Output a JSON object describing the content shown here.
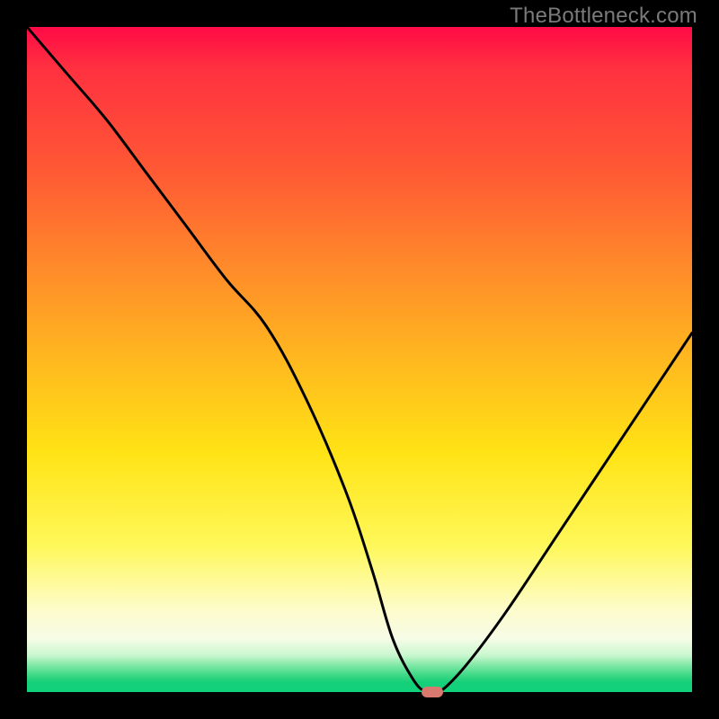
{
  "watermark": "TheBottleneck.com",
  "chart_data": {
    "type": "line",
    "title": "",
    "xlabel": "",
    "ylabel": "",
    "xlim": [
      0,
      100
    ],
    "ylim": [
      0,
      100
    ],
    "grid": false,
    "legend": false,
    "series": [
      {
        "name": "bottleneck-curve",
        "x": [
          0,
          6,
          12,
          18,
          24,
          30,
          36,
          42,
          48,
          52,
          55,
          58,
          60,
          62,
          66,
          72,
          80,
          88,
          96,
          100
        ],
        "y": [
          100,
          93,
          86,
          78,
          70,
          62,
          55,
          44,
          30,
          18,
          8,
          2,
          0,
          0,
          4,
          12,
          24,
          36,
          48,
          54
        ]
      }
    ],
    "marker": {
      "x": 61,
      "y": 0,
      "color": "#d9786f"
    },
    "gradient_stops": [
      {
        "pct": 0,
        "color": "#ff0a46"
      },
      {
        "pct": 22,
        "color": "#ff5a34"
      },
      {
        "pct": 50,
        "color": "#ffb81f"
      },
      {
        "pct": 78,
        "color": "#fff85a"
      },
      {
        "pct": 92,
        "color": "#f6fce6"
      },
      {
        "pct": 97,
        "color": "#3cd885"
      },
      {
        "pct": 100,
        "color": "#0fd27c"
      }
    ]
  }
}
